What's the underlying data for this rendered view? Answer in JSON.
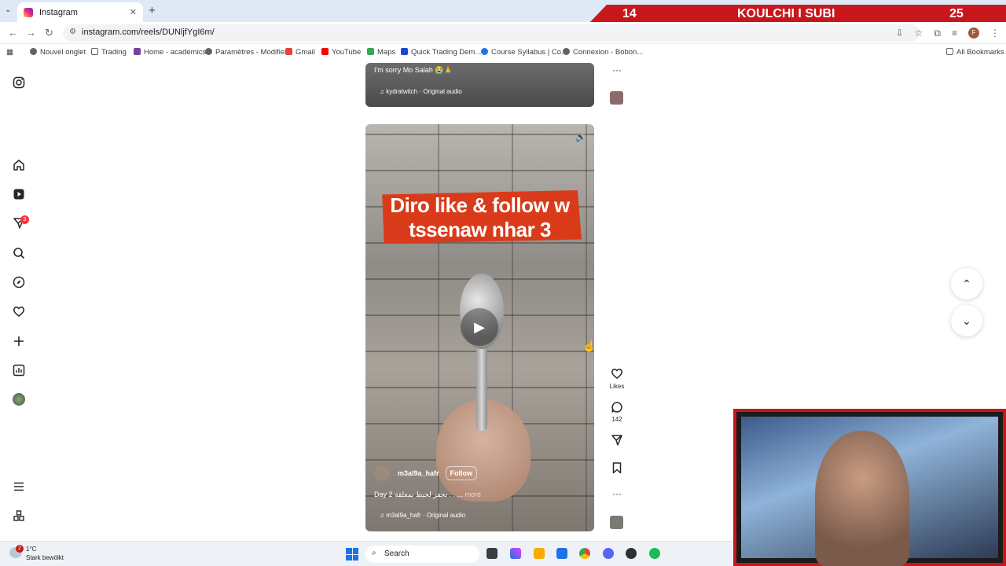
{
  "browser": {
    "tab_title": "Instagram",
    "url": "instagram.com/reels/DUNljfYgI6m/",
    "bookmarks": [
      "Nouvel onglet",
      "Trading",
      "Home - academics",
      "Paramètres - Modifier",
      "Gmail",
      "YouTube",
      "Maps",
      "Quick Trading Dem...",
      "Course Syllabus | Co...",
      "Connexion - Bobon..."
    ],
    "all_bookmarks": "All Bookmarks",
    "profile_initial": "F"
  },
  "stream_overlay": {
    "score_left": "14",
    "title": "KOULCHI I SUBI",
    "score_right": "25"
  },
  "sidebar": {
    "notifications_count": "3"
  },
  "previous_reel": {
    "caption": "I'm sorry Mo Salah 😭🙏",
    "audio": "kydratwitch · Original audio"
  },
  "current_reel": {
    "overlay_text": "Diro like & follow w tssenaw nhar 3",
    "username": "m3al9a_hafr",
    "follow_label": "Follow",
    "description": "Day 2 تحفر لحيط بمعلقة . . ...",
    "more_label": "more",
    "audio": "m3al9a_hafr · Original audio"
  },
  "actions": {
    "likes_label": "Likes",
    "comments_count": "142"
  },
  "taskbar": {
    "temperature": "1°C",
    "weather_desc": "Stark bewölkt",
    "weather_badge": "2",
    "search_placeholder": "Search"
  },
  "colors": {
    "accent_red": "#c8171c",
    "instagram_badge": "#ff3040"
  }
}
